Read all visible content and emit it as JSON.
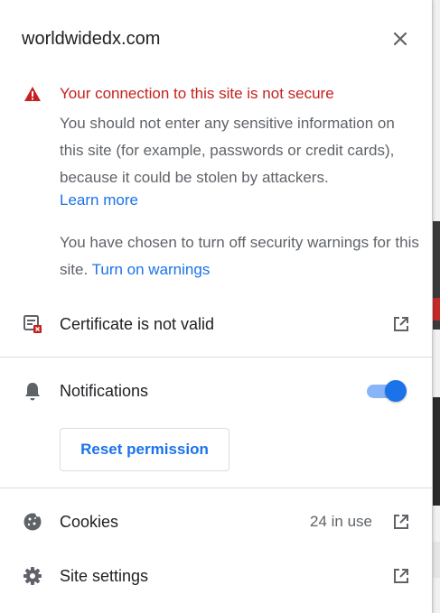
{
  "site": {
    "title": "worldwidedx.com"
  },
  "security": {
    "title": "Your connection to this site is not secure",
    "body": "You should not enter any sensitive information on this site (for example, passwords or credit cards), because it could be stolen by attackers.",
    "learn_more": "Learn more",
    "off_text": "You have chosen to turn off security warnings for this site.",
    "turn_on": "Turn on warnings"
  },
  "certificate": {
    "label": "Certificate is not valid"
  },
  "notifications": {
    "label": "Notifications",
    "enabled": true,
    "reset_label": "Reset permission"
  },
  "cookies": {
    "label": "Cookies",
    "count": "24 in use"
  },
  "site_settings": {
    "label": "Site settings"
  },
  "colors": {
    "warning": "#c5221f",
    "link": "#1a73e8",
    "toggle_track": "#8ab4f8"
  }
}
